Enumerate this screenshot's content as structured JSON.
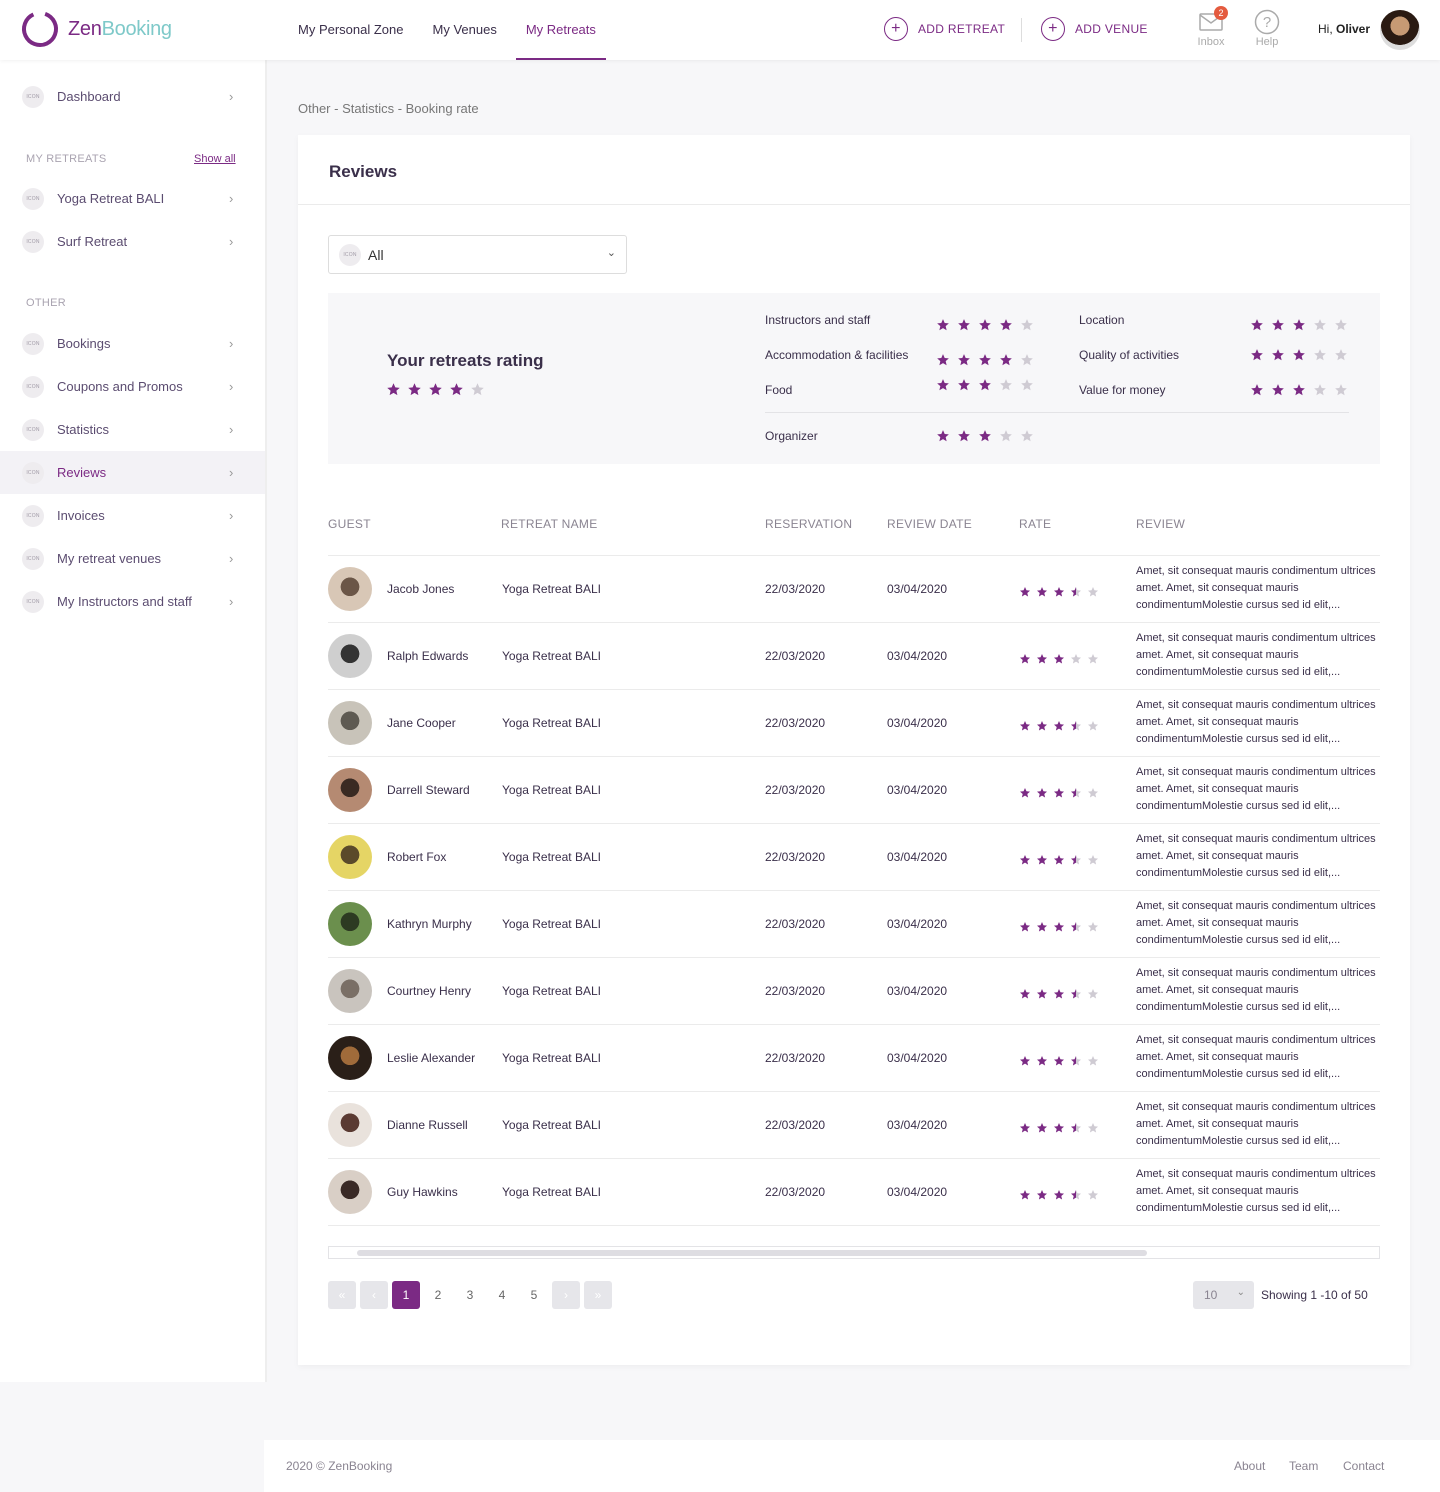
{
  "header": {
    "logo_zen": "Zen",
    "logo_booking": "Booking",
    "nav": [
      "My Personal Zone",
      "My Venues",
      "My Retreats"
    ],
    "add_retreat": "ADD RETREAT",
    "add_venue": "ADD VENUE",
    "inbox_label": "Inbox",
    "inbox_badge": "2",
    "help_label": "Help",
    "greeting_prefix": "Hi, ",
    "greeting_name": "Oliver",
    "accent_color": "#7b2a84"
  },
  "sidebar": {
    "icon_text": "ICON",
    "dashboard": "Dashboard",
    "my_retreats_title": "MY RETREATS",
    "show_all": "Show all",
    "retreats": [
      "Yoga Retreat BALI",
      "Surf Retreat"
    ],
    "other_title": "OTHER",
    "other_items": [
      "Bookings",
      "Coupons and Promos",
      "Statistics",
      "Reviews",
      "Invoices",
      "My retreat venues",
      "My Instructors and staff"
    ],
    "active_item": "Reviews"
  },
  "breadcrumb": "Other - Statistics - Booking rate",
  "card": {
    "title": "Reviews",
    "filter_value": "All",
    "rating_title": "Your retreats rating",
    "overall_rating": 4,
    "criteria": [
      {
        "label": "Instructors and staff",
        "rating": 4
      },
      {
        "label": "Accommodation & facilities",
        "rating": 4
      },
      {
        "label": "Food",
        "rating": 3
      },
      {
        "label": "Location",
        "rating": 3
      },
      {
        "label": "Quality of activities",
        "rating": 3
      },
      {
        "label": "Value for money",
        "rating": 3
      },
      {
        "label": "Organizer",
        "rating": 3
      }
    ]
  },
  "table": {
    "headers": [
      "GUEST",
      "RETREAT NAME",
      "RESERVATION",
      "REVIEW DATE",
      "RATE",
      "REVIEW"
    ],
    "rows": [
      {
        "guest": "Jacob Jones",
        "retreat": "Yoga Retreat BALI",
        "reservation": "22/03/2020",
        "review_date": "03/04/2020",
        "rate": 3.5,
        "review": "Amet, sit consequat mauris condimentum ultrices amet. Amet, sit consequat mauris condimentumMolestie cursus sed id elit,..."
      },
      {
        "guest": "Ralph Edwards",
        "retreat": "Yoga Retreat BALI",
        "reservation": "22/03/2020",
        "review_date": "03/04/2020",
        "rate": 3,
        "review": "Amet, sit consequat mauris condimentum ultrices amet. Amet, sit consequat mauris condimentumMolestie cursus sed id elit,..."
      },
      {
        "guest": "Jane Cooper",
        "retreat": "Yoga Retreat BALI",
        "reservation": "22/03/2020",
        "review_date": "03/04/2020",
        "rate": 3.5,
        "review": "Amet, sit consequat mauris condimentum ultrices amet. Amet, sit consequat mauris condimentumMolestie cursus sed id elit,..."
      },
      {
        "guest": "Darrell Steward",
        "retreat": "Yoga Retreat BALI",
        "reservation": "22/03/2020",
        "review_date": "03/04/2020",
        "rate": 3.5,
        "review": "Amet, sit consequat mauris condimentum ultrices amet. Amet, sit consequat mauris condimentumMolestie cursus sed id elit,..."
      },
      {
        "guest": "Robert Fox",
        "retreat": "Yoga Retreat BALI",
        "reservation": "22/03/2020",
        "review_date": "03/04/2020",
        "rate": 3.5,
        "review": "Amet, sit consequat mauris condimentum ultrices amet. Amet, sit consequat mauris condimentumMolestie cursus sed id elit,..."
      },
      {
        "guest": "Kathryn Murphy",
        "retreat": "Yoga Retreat BALI",
        "reservation": "22/03/2020",
        "review_date": "03/04/2020",
        "rate": 3.5,
        "review": "Amet, sit consequat mauris condimentum ultrices amet. Amet, sit consequat mauris condimentumMolestie cursus sed id elit,..."
      },
      {
        "guest": "Courtney Henry",
        "retreat": "Yoga Retreat BALI",
        "reservation": "22/03/2020",
        "review_date": "03/04/2020",
        "rate": 3.5,
        "review": "Amet, sit consequat mauris condimentum ultrices amet. Amet, sit consequat mauris condimentumMolestie cursus sed id elit,..."
      },
      {
        "guest": "Leslie Alexander",
        "retreat": "Yoga Retreat BALI",
        "reservation": "22/03/2020",
        "review_date": "03/04/2020",
        "rate": 3.5,
        "review": "Amet, sit consequat mauris condimentum ultrices amet. Amet, sit consequat mauris condimentumMolestie cursus sed id elit,..."
      },
      {
        "guest": "Dianne Russell",
        "retreat": "Yoga Retreat BALI",
        "reservation": "22/03/2020",
        "review_date": "03/04/2020",
        "rate": 3.5,
        "review": "Amet, sit consequat mauris condimentum ultrices amet. Amet, sit consequat mauris condimentumMolestie cursus sed id elit,..."
      },
      {
        "guest": "Guy Hawkins",
        "retreat": "Yoga Retreat BALI",
        "reservation": "22/03/2020",
        "review_date": "03/04/2020",
        "rate": 3.5,
        "review": "Amet, sit consequat mauris condimentum ultrices amet. Amet, sit consequat mauris condimentumMolestie cursus sed id elit,..."
      }
    ]
  },
  "pagination": {
    "pages": [
      "1",
      "2",
      "3",
      "4",
      "5"
    ],
    "current": "1",
    "per_page": "10",
    "showing": "Showing 1 -10 of 50"
  },
  "footer": {
    "copyright": "2020 © ZenBooking",
    "links": [
      "About",
      "Team",
      "Contact"
    ]
  }
}
